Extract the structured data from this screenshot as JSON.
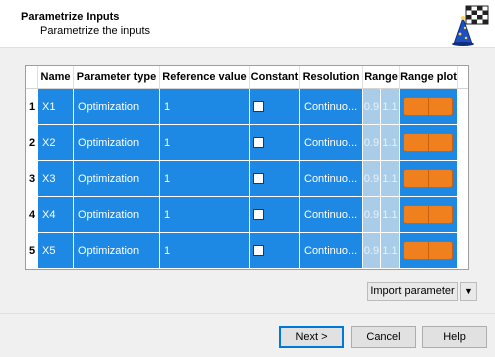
{
  "header": {
    "title": "Parametrize Inputs",
    "subtitle": "Parametrize the inputs"
  },
  "table": {
    "columns": [
      "Name",
      "Parameter type",
      "Reference value",
      "Constant",
      "Resolution",
      "Range",
      "Range plot"
    ],
    "rows": [
      {
        "num": "1",
        "name": "X1",
        "type": "Optimization",
        "ref": "1",
        "constant": false,
        "resolution": "Continuo...",
        "range_min": "0.9",
        "range_max": "1.1"
      },
      {
        "num": "2",
        "name": "X2",
        "type": "Optimization",
        "ref": "1",
        "constant": false,
        "resolution": "Continuo...",
        "range_min": "0.9",
        "range_max": "1.1"
      },
      {
        "num": "3",
        "name": "X3",
        "type": "Optimization",
        "ref": "1",
        "constant": false,
        "resolution": "Continuo...",
        "range_min": "0.9",
        "range_max": "1.1"
      },
      {
        "num": "4",
        "name": "X4",
        "type": "Optimization",
        "ref": "1",
        "constant": false,
        "resolution": "Continuo...",
        "range_min": "0.9",
        "range_max": "1.1"
      },
      {
        "num": "5",
        "name": "X5",
        "type": "Optimization",
        "ref": "1",
        "constant": false,
        "resolution": "Continuo...",
        "range_min": "0.9",
        "range_max": "1.1"
      }
    ]
  },
  "buttons": {
    "import": "Import parameter",
    "next": "Next >",
    "cancel": "Cancel",
    "help": "Help"
  },
  "colors": {
    "row_selected": "#1e88e5",
    "range_cell": "#a9cde8",
    "range_plot": "#f07f1e"
  }
}
